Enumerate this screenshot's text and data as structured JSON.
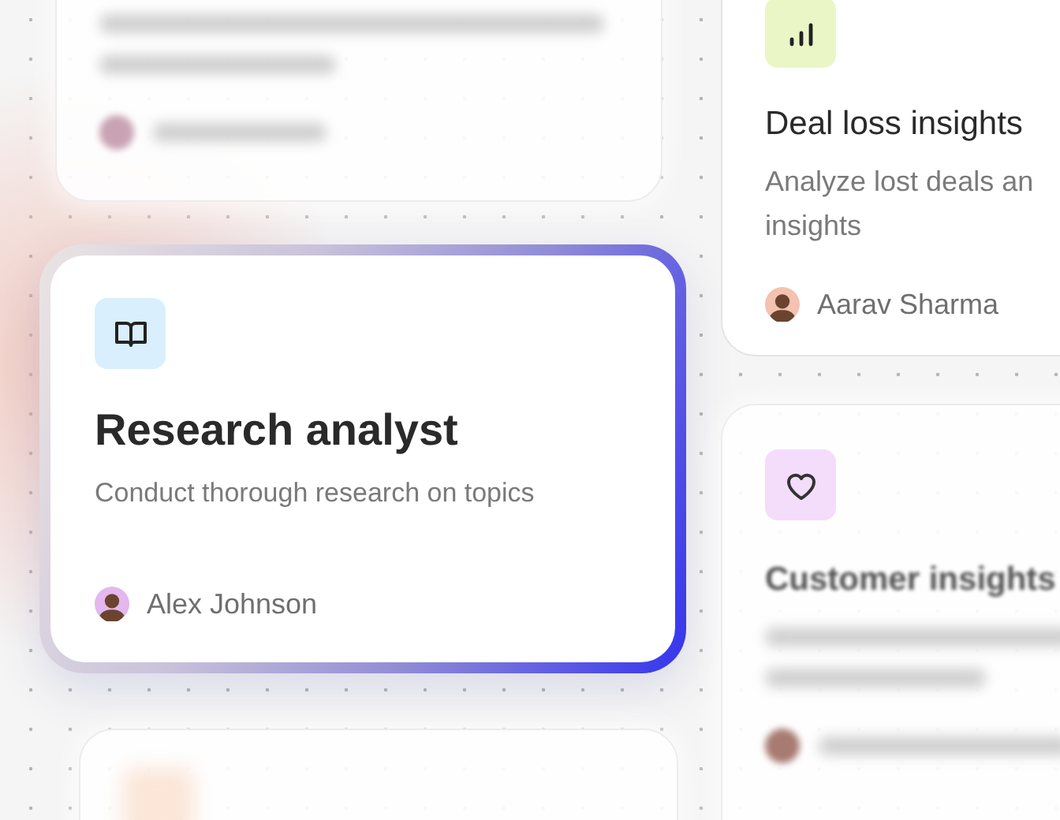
{
  "cards": [
    {
      "kind": "blurred"
    },
    {
      "kind": "focused",
      "title": "Research analyst",
      "description": "Conduct thorough research on topics",
      "author": "Alex Johnson"
    },
    {
      "kind": "plain",
      "title": "Deal loss insights",
      "description": "Analyze lost deals an insights",
      "author": "Aarav Sharma"
    },
    {
      "kind": "blurred",
      "title": "Customer insights"
    },
    {
      "kind": "blurred"
    }
  ]
}
